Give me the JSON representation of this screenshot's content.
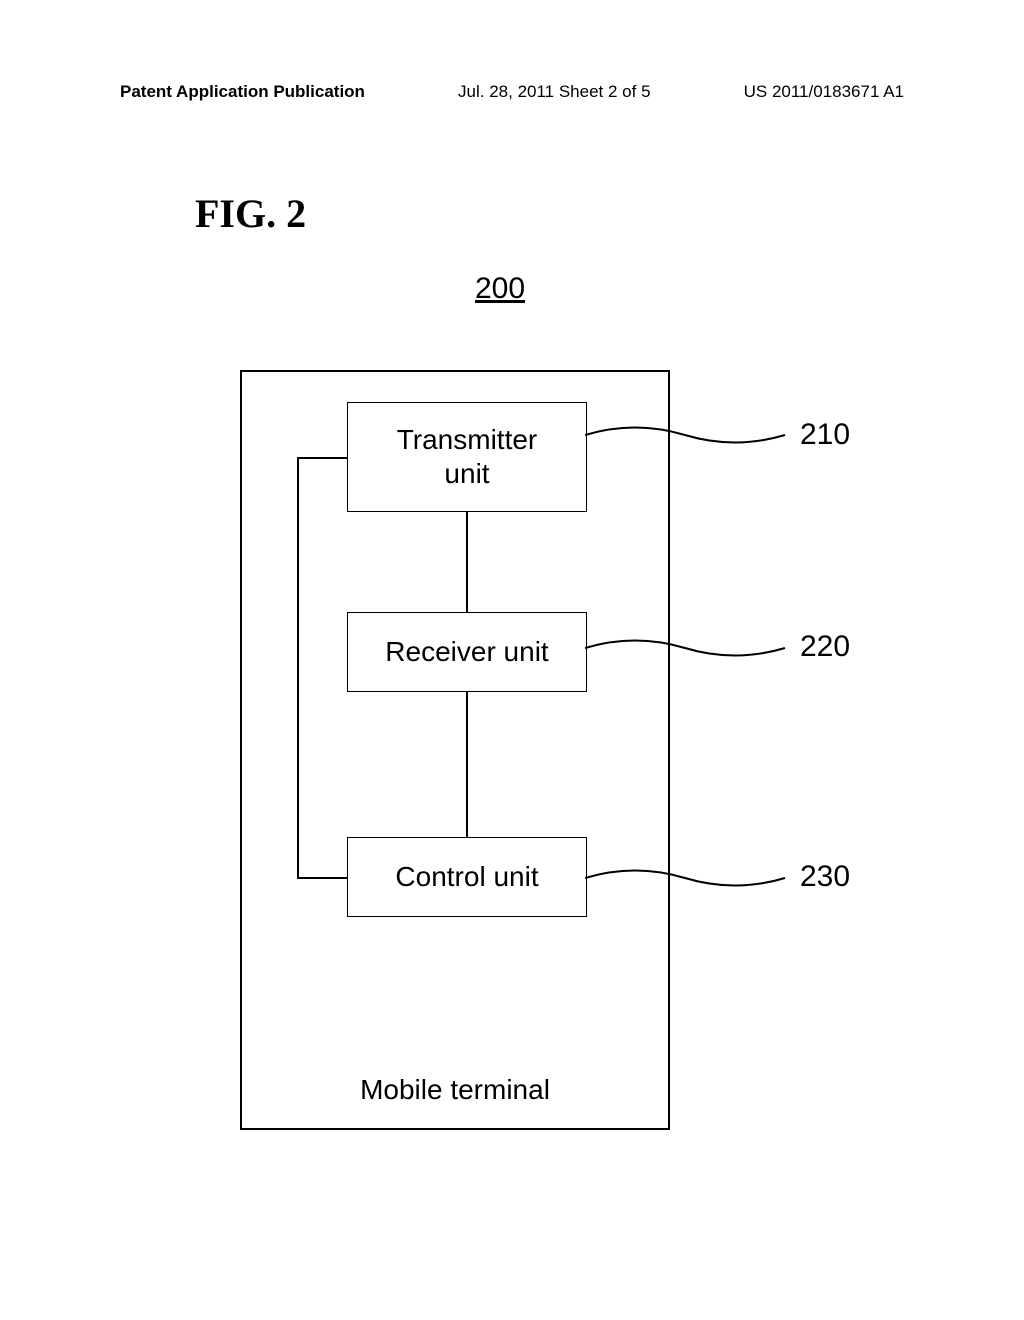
{
  "header": {
    "left": "Patent Application Publication",
    "center": "Jul. 28, 2011  Sheet 2 of 5",
    "right": "US 2011/0183671 A1"
  },
  "figure_label": "FIG. 2",
  "ref_main": "200",
  "container_label": "Mobile terminal",
  "units": {
    "transmitter": {
      "line1": "Transmitter",
      "line2": "unit"
    },
    "receiver": "Receiver unit",
    "control": "Control unit"
  },
  "refs": {
    "r210": "210",
    "r220": "220",
    "r230": "230"
  },
  "chart_data": {
    "type": "diagram",
    "title": "FIG. 2",
    "reference": "200",
    "container": "Mobile terminal",
    "components": [
      {
        "id": "210",
        "name": "Transmitter unit"
      },
      {
        "id": "220",
        "name": "Receiver unit"
      },
      {
        "id": "230",
        "name": "Control unit"
      }
    ],
    "connections": [
      {
        "from": "210",
        "to": "220"
      },
      {
        "from": "220",
        "to": "230"
      },
      {
        "from": "210",
        "to": "230",
        "via": "left-bus"
      }
    ]
  }
}
